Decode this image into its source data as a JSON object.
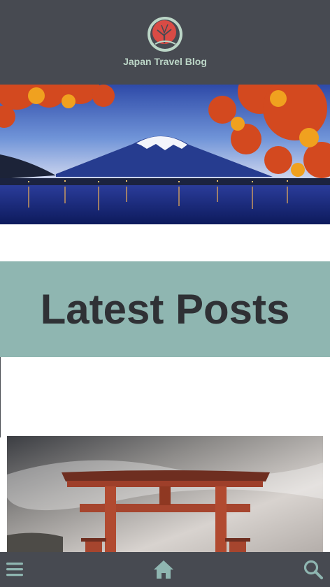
{
  "header": {
    "site_title": "Japan Travel Blog",
    "logo_icon": "japan-tree-logo"
  },
  "hero": {
    "image": "mount-fuji-autumn-lake"
  },
  "latest": {
    "title": "Latest Posts"
  },
  "post": {
    "image": "torii-gate-cloudy-sky"
  },
  "bottom_nav": {
    "menu_icon": "menu-icon",
    "home_icon": "home-icon",
    "search_icon": "search-icon"
  },
  "colors": {
    "header_bg": "#474a51",
    "accent": "#8fb6b1",
    "title_text": "#bcd6c7",
    "heading_text": "#2f3135",
    "logo_red": "#d94b45"
  }
}
